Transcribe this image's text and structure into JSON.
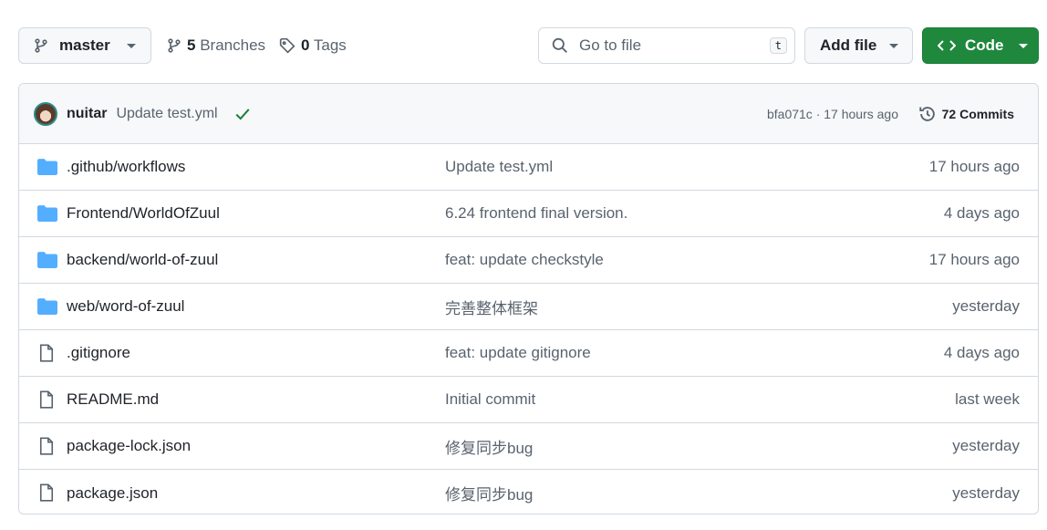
{
  "toolbar": {
    "branch": "master",
    "branches_count": "5",
    "branches_label": "Branches",
    "tags_count": "0",
    "tags_label": "Tags",
    "search_placeholder": "Go to file",
    "search_shortcut": "t",
    "add_file": "Add file",
    "code": "Code",
    "accent": "#1f883d"
  },
  "commit": {
    "author": "nuitar",
    "message": "Update test.yml",
    "status": "success",
    "hash": "bfa071c",
    "time": "17 hours ago",
    "sep": "·",
    "commits_count": "72",
    "commits_label": "Commits"
  },
  "files": [
    {
      "type": "folder",
      "name": ".github/workflows",
      "message": "Update test.yml",
      "age": "17 hours ago"
    },
    {
      "type": "folder",
      "name": "Frontend/WorldOfZuul",
      "message": "6.24 frontend final version.",
      "age": "4 days ago"
    },
    {
      "type": "folder",
      "name": "backend/world-of-zuul",
      "message": "feat: update checkstyle",
      "age": "17 hours ago"
    },
    {
      "type": "folder",
      "name": "web/word-of-zuul",
      "message": "完善整体框架",
      "age": "yesterday"
    },
    {
      "type": "file",
      "name": ".gitignore",
      "message": "feat: update gitignore",
      "age": "4 days ago"
    },
    {
      "type": "file",
      "name": "README.md",
      "message": "Initial commit",
      "age": "last week"
    },
    {
      "type": "file",
      "name": "package-lock.json",
      "message": "修复同步bug",
      "age": "yesterday"
    },
    {
      "type": "file",
      "name": "package.json",
      "message": "修复同步bug",
      "age": "yesterday"
    }
  ]
}
